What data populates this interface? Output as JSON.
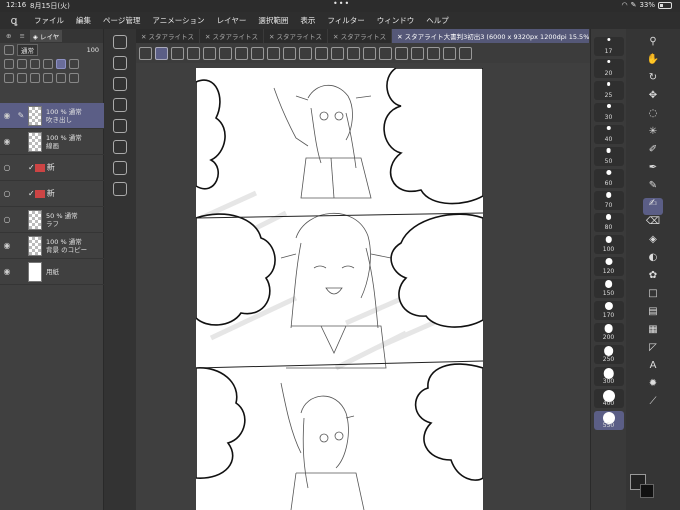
{
  "status": {
    "time": "12:16",
    "date": "8月15日(火)",
    "battery": "33%",
    "battery_level": 0.33
  },
  "menu": {
    "items": [
      "ファイル",
      "編集",
      "ページ管理",
      "アニメーション",
      "レイヤー",
      "選択範囲",
      "表示",
      "フィルター",
      "ウィンドウ",
      "ヘルプ"
    ]
  },
  "layer_panel": {
    "tab_label": "レイヤ",
    "blend_mode": "通常",
    "opacity": "100",
    "layers": [
      {
        "opacity_mode": "100 % 通常",
        "name": "吹き出し",
        "visible": true,
        "selected": true
      },
      {
        "opacity_mode": "100 % 通常",
        "name": "線画",
        "visible": true,
        "selected": false
      },
      {
        "opacity_mode": "",
        "name": "",
        "visible": false,
        "selected": false,
        "folder": true,
        "folder_label": "新"
      },
      {
        "opacity_mode": "",
        "name": "",
        "visible": false,
        "selected": false,
        "folder": true,
        "folder_label": "新"
      },
      {
        "opacity_mode": "50 % 通常",
        "name": "ラフ",
        "visible": false,
        "selected": false
      },
      {
        "opacity_mode": "100 % 通常",
        "name": "背景 のコピー",
        "visible": true,
        "selected": false
      },
      {
        "opacity_mode": "",
        "name": "用紙",
        "visible": true,
        "selected": false,
        "paper": true
      }
    ]
  },
  "tabs": [
    "スタアライトス",
    "スタアライトス",
    "スタアライトス",
    "スタアライトス",
    "スタアライト大書判3初出3 (6000 x 9320px 1200dpi 15.5%)"
  ],
  "brushes": [
    "17",
    "20",
    "25",
    "30",
    "40",
    "50",
    "60",
    "70",
    "80",
    "100",
    "120",
    "150",
    "170",
    "200",
    "250",
    "300",
    "400",
    "550"
  ],
  "right_tools": [
    "magnifier-icon",
    "hand-icon",
    "rotate-icon",
    "move-icon",
    "lasso-icon",
    "wand-icon",
    "eyedropper-icon",
    "pen-icon",
    "pencil-icon",
    "brush-icon",
    "eraser-icon",
    "fill-icon",
    "blend-icon",
    "decoration-icon",
    "shape-icon",
    "gradient-icon",
    "frame-icon",
    "ruler-icon",
    "text-icon",
    "balloon-icon",
    "correct-line-icon"
  ],
  "right_tool_glyphs": [
    "⚲",
    "✋",
    "↻",
    "✥",
    "◌",
    "✳",
    "✐",
    "✒",
    "✎",
    "✍",
    "⌫",
    "◈",
    "◐",
    "✿",
    "□",
    "▤",
    "▦",
    "◸",
    "A",
    "✹",
    "⟋"
  ],
  "active_tool_index": 9,
  "colors": {
    "accent": "#5b5e86",
    "panel": "#3a3a3a"
  }
}
